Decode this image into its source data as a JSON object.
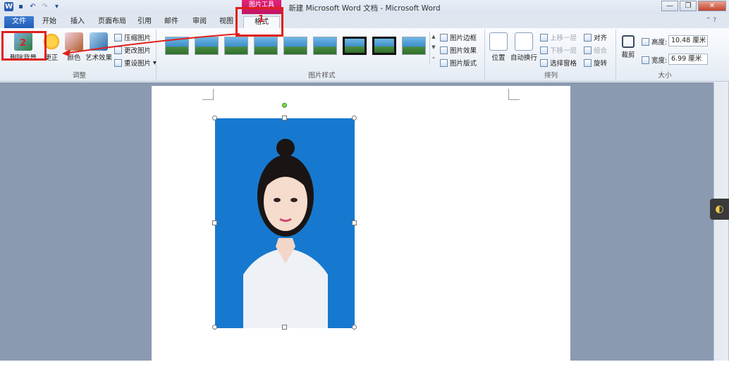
{
  "window": {
    "title": "新建 Microsoft Word 文档 - Microsoft Word",
    "context_tool": "图片工具",
    "controls": [
      "—",
      "❐",
      "✕"
    ]
  },
  "tabs": [
    {
      "label": "文件"
    },
    {
      "label": "开始"
    },
    {
      "label": "插入"
    },
    {
      "label": "页面布局"
    },
    {
      "label": "引用"
    },
    {
      "label": "邮件"
    },
    {
      "label": "审阅"
    },
    {
      "label": "视图"
    },
    {
      "label": "格式"
    }
  ],
  "ribbon": {
    "adjust": {
      "group_label": "调整",
      "remove_bg": "删除背景",
      "correct": "更正",
      "color": "颜色",
      "art_effects": "艺术效果",
      "compress": "压缩图片",
      "change": "更改图片",
      "reset": "重设图片"
    },
    "styles": {
      "group_label": "图片样式",
      "border": "图片边框",
      "effects": "图片效果",
      "layout": "图片版式"
    },
    "arrange": {
      "group_label": "排列",
      "position": "位置",
      "wrap": "自动换行",
      "bring_forward": "上移一层",
      "send_backward": "下移一层",
      "selection_pane": "选择窗格",
      "align": "对齐",
      "group": "组合",
      "rotate": "旋转"
    },
    "size": {
      "group_label": "大小",
      "crop": "裁剪",
      "height_label": "高度:",
      "height_value": "10.48 厘米",
      "width_label": "宽度:",
      "width_value": "6.99 厘米"
    }
  },
  "annotations": {
    "step1": "1",
    "step2": "2"
  },
  "colors": {
    "photo_background": "#1679cf",
    "annotation_red": "#e0201b",
    "file_tab_blue": "#2a63b8"
  }
}
